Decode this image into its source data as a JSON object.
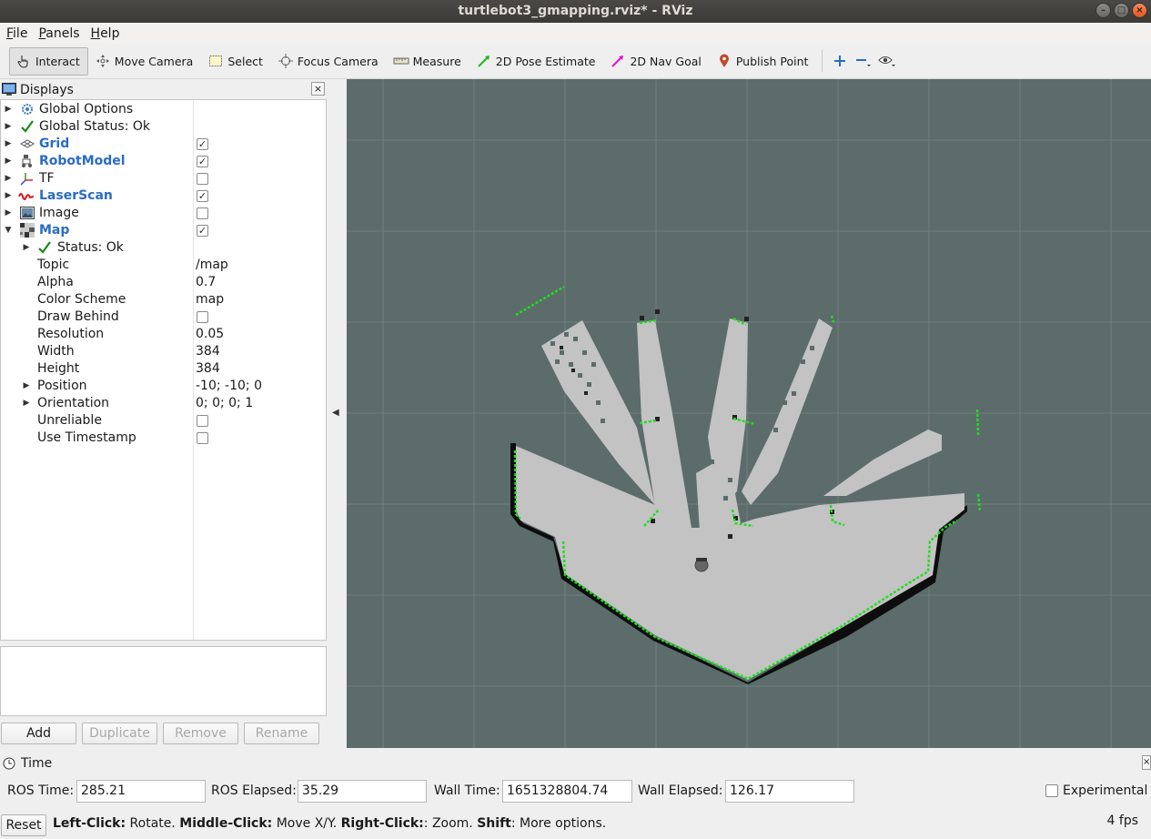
{
  "window": {
    "title": "turtlebot3_gmapping.rviz* - RViz"
  },
  "menubar": {
    "items": [
      {
        "label": "File",
        "underline": "F",
        "rest": "ile"
      },
      {
        "label": "Panels",
        "underline": "P",
        "rest": "anels"
      },
      {
        "label": "Help",
        "underline": "H",
        "rest": "elp"
      }
    ]
  },
  "toolbar": {
    "interact": "Interact",
    "move_camera": "Move Camera",
    "select": "Select",
    "focus_camera": "Focus Camera",
    "measure": "Measure",
    "pose_estimate": "2D Pose Estimate",
    "nav_goal": "2D Nav Goal",
    "publish_point": "Publish Point"
  },
  "displays": {
    "title": "Displays",
    "rows": [
      {
        "label": "Global Options"
      },
      {
        "label": "Global Status: Ok"
      },
      {
        "label": "Grid",
        "checked": true
      },
      {
        "label": "RobotModel",
        "checked": true
      },
      {
        "label": "TF",
        "checked": false
      },
      {
        "label": "LaserScan",
        "checked": true
      },
      {
        "label": "Image",
        "checked": false
      },
      {
        "label": "Map",
        "checked": true
      },
      {
        "label": "Status: Ok"
      },
      {
        "label": "Topic",
        "value": "/map"
      },
      {
        "label": "Alpha",
        "value": "0.7"
      },
      {
        "label": "Color Scheme",
        "value": "map"
      },
      {
        "label": "Draw Behind",
        "checked": false
      },
      {
        "label": "Resolution",
        "value": "0.05"
      },
      {
        "label": "Width",
        "value": "384"
      },
      {
        "label": "Height",
        "value": "384"
      },
      {
        "label": "Position",
        "value": "-10; -10; 0"
      },
      {
        "label": "Orientation",
        "value": "0; 0; 0; 1"
      },
      {
        "label": "Unreliable",
        "checked": false
      },
      {
        "label": "Use Timestamp",
        "checked": false
      }
    ],
    "buttons": {
      "add": "Add",
      "duplicate": "Duplicate",
      "remove": "Remove",
      "rename": "Rename"
    }
  },
  "time": {
    "title": "Time",
    "ros_time_label": "ROS Time:",
    "ros_time": "285.21",
    "ros_elapsed_label": "ROS Elapsed:",
    "ros_elapsed": "35.29",
    "wall_time_label": "Wall Time:",
    "wall_time": "1651328804.74",
    "wall_elapsed_label": "Wall Elapsed:",
    "wall_elapsed": "126.17",
    "experimental": "Experimental"
  },
  "status": {
    "reset": "Reset",
    "h1": "Left-Click:",
    "t1": " Rotate. ",
    "h2": "Middle-Click:",
    "t2": " Move X/Y. ",
    "h3": "Right-Click:",
    "t3": ": Zoom. ",
    "h4": "Shift",
    "t4": ": More options.",
    "fps": "4 fps"
  },
  "colors": {
    "viewport_bg": "#5b6c6a",
    "free_space": "#c3c3c3",
    "occupied": "#0d0d0d",
    "laser": "#22dd22",
    "highlight_label": "#2a6cc4"
  }
}
